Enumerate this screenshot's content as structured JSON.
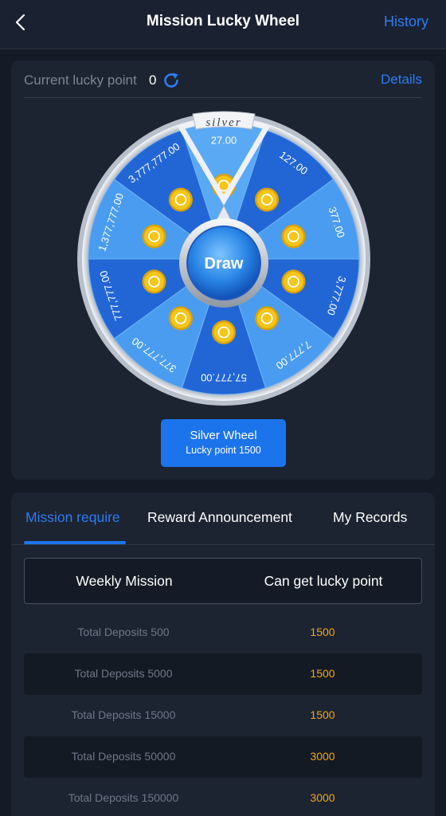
{
  "header": {
    "title": "Mission Lucky Wheel",
    "history_label": "History"
  },
  "lucky": {
    "label": "Current lucky point",
    "value": "0",
    "details_label": "Details"
  },
  "wheel": {
    "tier_label": "silver",
    "draw_label": "Draw",
    "prizes": [
      "27.00",
      "127.00",
      "377.00",
      "3,777.00",
      "7,777.00",
      "57,777.00",
      "377,777.00",
      "777,777.00",
      "1,377,777.00",
      "3,777,777.00"
    ],
    "colors": {
      "light_segment": "#4a9cf0",
      "dark_segment": "#2266d6",
      "coin": "#f5c518",
      "selected_segment": "#5aa9f5"
    }
  },
  "draw_button": {
    "title": "Silver Wheel",
    "subtitle": "Lucky point 1500"
  },
  "tabs": {
    "mission": "Mission require",
    "reward": "Reward Announcement",
    "records": "My Records"
  },
  "table": {
    "header_task": "Weekly Mission",
    "header_points": "Can get lucky point",
    "rows": [
      {
        "task": "Total Deposits 500",
        "points": "1500"
      },
      {
        "task": "Total Deposits 5000",
        "points": "1500"
      },
      {
        "task": "Total Deposits 15000",
        "points": "1500"
      },
      {
        "task": "Total Deposits 50000",
        "points": "3000"
      },
      {
        "task": "Total Deposits 150000",
        "points": "3000"
      }
    ]
  },
  "colors": {
    "accent": "#2d7df3",
    "points": "#f2a51e",
    "background": "#151b26"
  }
}
